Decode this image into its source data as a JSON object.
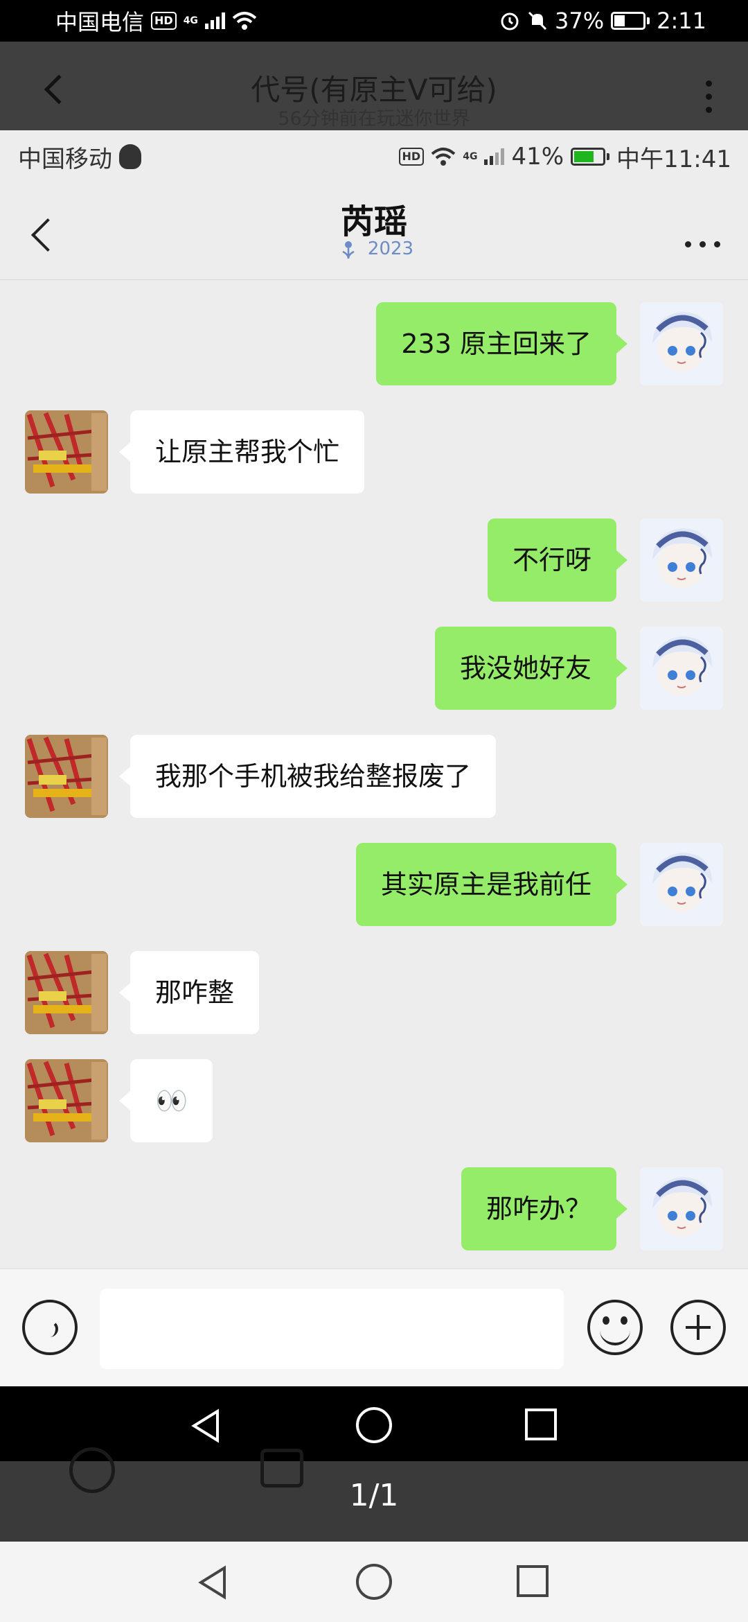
{
  "outer_status": {
    "carrier": "中国电信",
    "hd": "HD",
    "network": "4G",
    "battery": "37%",
    "time": "2:11"
  },
  "outer_header": {
    "title": "代号(有原主V可给)",
    "subtitle": "56分钟前在玩迷你世界"
  },
  "inner_status": {
    "carrier": "中国移动",
    "hd": "HD",
    "network": "4G",
    "battery": "41%",
    "time": "中午11:41"
  },
  "chat": {
    "name": "芮瑶",
    "tag": "2023",
    "messages": [
      {
        "side": "me",
        "text": "233 原主回来了"
      },
      {
        "side": "other",
        "text": "让原主帮我个忙"
      },
      {
        "side": "me",
        "text": "不行呀"
      },
      {
        "side": "me",
        "text": "我没她好友"
      },
      {
        "side": "other",
        "text": "我那个手机被我给整报废了"
      },
      {
        "side": "me",
        "text": "其实原主是我前任"
      },
      {
        "side": "other",
        "text": "那咋整"
      },
      {
        "side": "other",
        "text": "👀"
      },
      {
        "side": "me",
        "text": "那咋办？"
      }
    ]
  },
  "outer_toolbar": {
    "page_indicator": "1/1"
  },
  "colors": {
    "bubble_me": "#95ec69",
    "bubble_other": "#ffffff",
    "chat_bg": "#ededed"
  },
  "icons": [
    "back-icon",
    "more-icon",
    "voice-icon",
    "emoji-icon",
    "plus-icon",
    "nav-back-icon",
    "nav-home-icon",
    "nav-recent-icon"
  ]
}
